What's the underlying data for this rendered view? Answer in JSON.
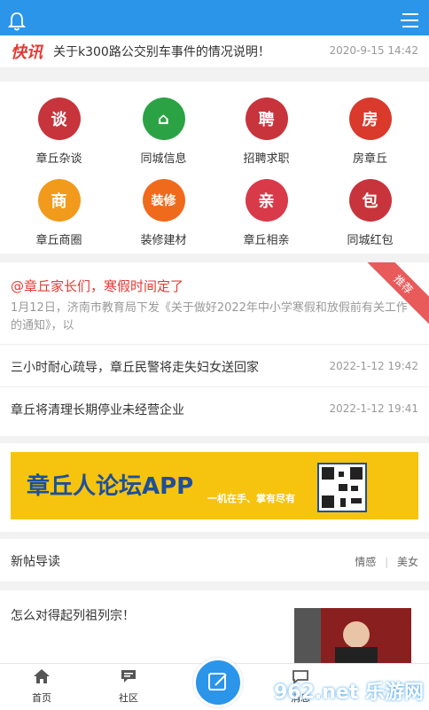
{
  "news_ticker": {
    "badge": "快讯",
    "title": "关于k300路公交别车事件的情况说明！",
    "date": "2020-9-15 14:42"
  },
  "categories": [
    {
      "label": "章丘杂谈",
      "icon": "chat-icon",
      "color": "#c8343c"
    },
    {
      "label": "同城信息",
      "icon": "home-icon",
      "color": "#2ba344"
    },
    {
      "label": "招聘求职",
      "icon": "recruit-icon",
      "color": "#c8343c"
    },
    {
      "label": "房章丘",
      "icon": "house-icon",
      "color": "#d93a2c"
    },
    {
      "label": "章丘商圈",
      "icon": "shop-icon",
      "color": "#f29a1c"
    },
    {
      "label": "装修建材",
      "icon": "decor-icon",
      "color": "#f06a1c"
    },
    {
      "label": "章丘相亲",
      "icon": "dating-icon",
      "color": "#d83a4a"
    },
    {
      "label": "同城红包",
      "icon": "redpacket-icon",
      "color": "#c8343c"
    }
  ],
  "icon_glyphs": {
    "chat": "谈",
    "home": "⌂",
    "recruit": "聘",
    "house": "房",
    "shop": "商",
    "decor": "装修",
    "dating": "亲",
    "redpacket": "包"
  },
  "recommend": {
    "ribbon": "推荐",
    "headline": "@章丘家长们，寒假时间定了",
    "summary": "1月12日，济南市教育局下发《关于做好2022年中小学寒假和放假前有关工作的通知》，以",
    "items": [
      {
        "title": "三小时耐心疏导，章丘民警将走失妇女送回家",
        "date": "2022-1-12 19:42"
      },
      {
        "title": "章丘将清理长期停业未经营企业",
        "date": "2022-1-12 19:41"
      }
    ]
  },
  "banner": {
    "title": "章丘人论坛APP",
    "slogan": "一机在手、掌有尽有"
  },
  "new_posts": {
    "heading": "新帖导读",
    "tags": [
      "情感",
      "美女"
    ]
  },
  "post": {
    "title": "怎么对得起列祖列宗！"
  },
  "tabbar": [
    {
      "label": "首页",
      "icon": "home-tab-icon"
    },
    {
      "label": "社区",
      "icon": "community-tab-icon"
    },
    {
      "label": "消息",
      "icon": "message-tab-icon"
    }
  ],
  "watermark": "962.net 乐游网",
  "colors": {
    "primary": "#2b95ea",
    "accent": "#e53935"
  }
}
